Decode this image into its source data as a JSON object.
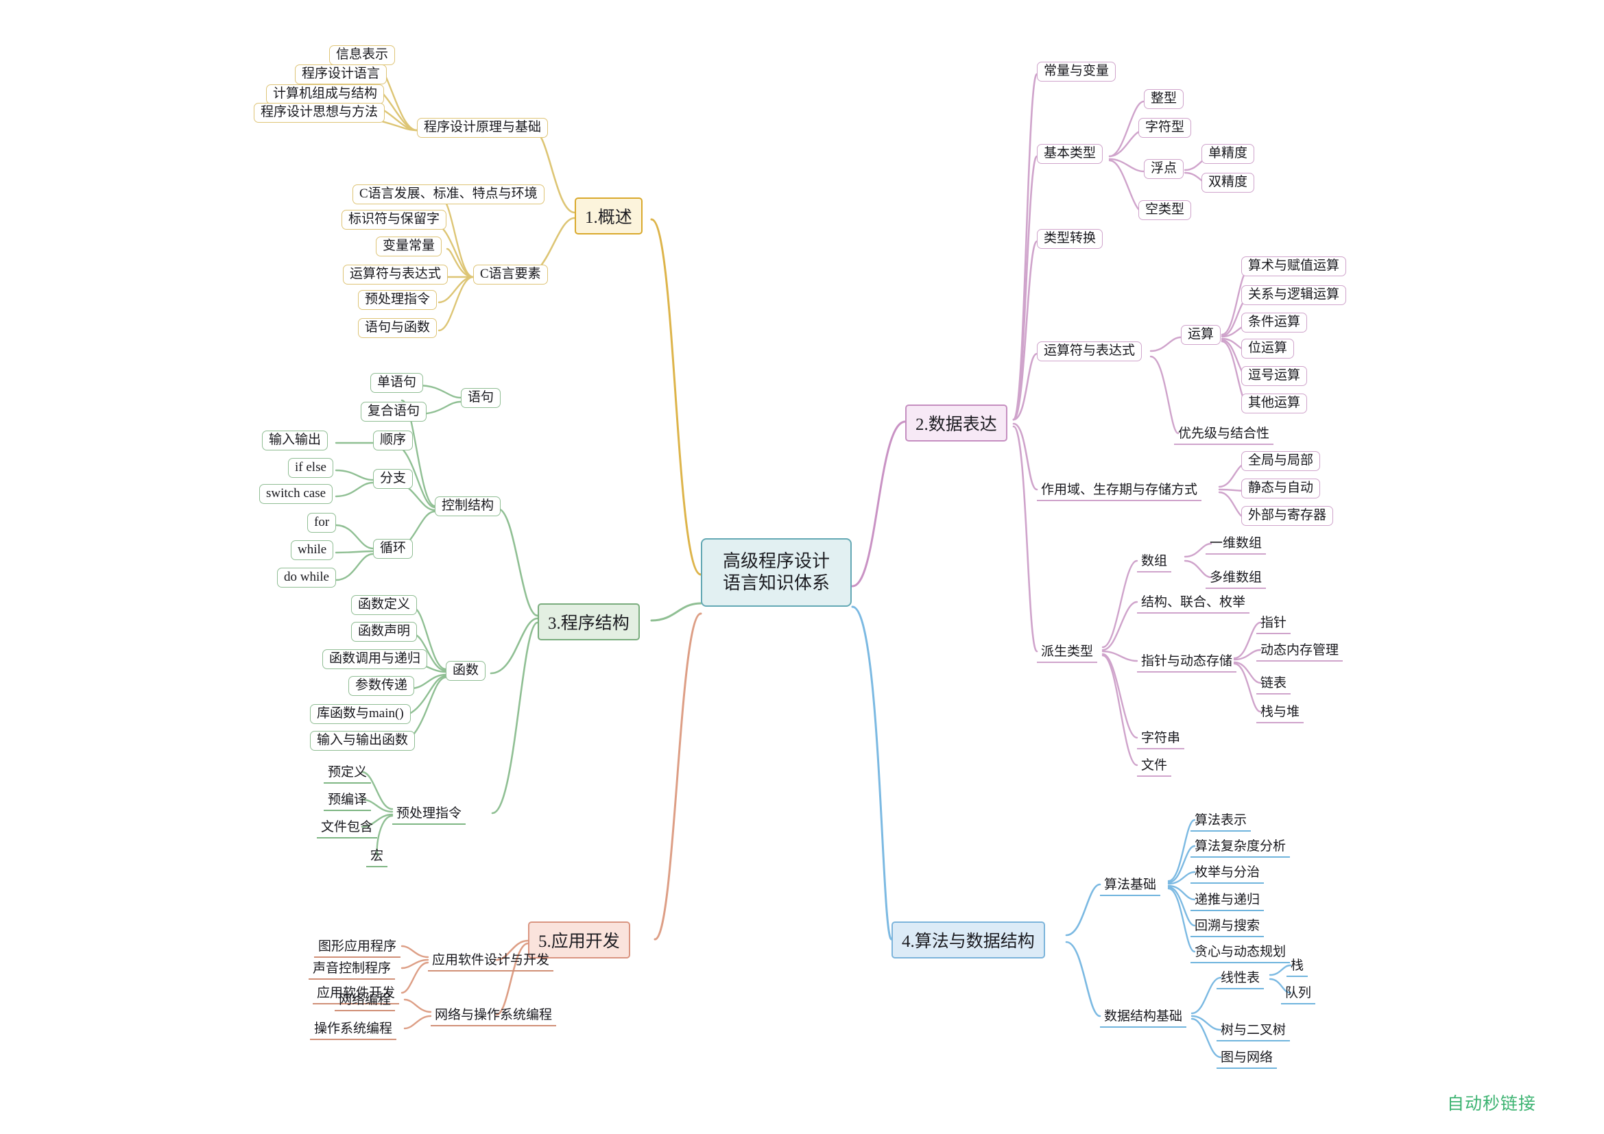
{
  "diagram": {
    "type": "mindmap",
    "root": {
      "label": "高级程序设计\n语言知识体系",
      "line1": "高级程序设计",
      "line2": "语言知识体系",
      "color": "#63a8b4",
      "fill": "#e2f0f2"
    },
    "watermark": "自动秒链接",
    "watermark_color": "#3cb371",
    "branches": [
      {
        "id": "b1",
        "label": "1.概述",
        "color": "#d9a92c",
        "fill": "#fcf4dc",
        "side": "left",
        "children": [
          {
            "label": "程序设计原理与基础",
            "children": [
              {
                "label": "信息表示"
              },
              {
                "label": "程序设计语言"
              },
              {
                "label": "计算机组成与结构"
              },
              {
                "label": "程序设计思想与方法"
              }
            ]
          },
          {
            "label": "C语言要素",
            "children": [
              {
                "label": "C语言发展、标准、特点与环境"
              },
              {
                "label": "标识符与保留字"
              },
              {
                "label": "变量常量"
              },
              {
                "label": "运算符与表达式"
              },
              {
                "label": "预处理指令"
              },
              {
                "label": "语句与函数"
              }
            ]
          }
        ]
      },
      {
        "id": "b2",
        "label": "2.数据表达",
        "color": "#c58ec0",
        "fill": "#f7e9f6",
        "side": "right",
        "children": [
          {
            "label": "常量与变量",
            "children": []
          },
          {
            "label": "基本类型",
            "children": [
              {
                "label": "整型"
              },
              {
                "label": "字符型"
              },
              {
                "label": "浮点",
                "children": [
                  {
                    "label": "单精度"
                  },
                  {
                    "label": "双精度"
                  }
                ]
              },
              {
                "label": "空类型"
              }
            ]
          },
          {
            "label": "类型转换",
            "children": []
          },
          {
            "label": "运算符与表达式",
            "children": [
              {
                "label": "运算",
                "children": [
                  {
                    "label": "算术与赋值运算"
                  },
                  {
                    "label": "关系与逻辑运算"
                  },
                  {
                    "label": "条件运算"
                  },
                  {
                    "label": "位运算"
                  },
                  {
                    "label": "逗号运算"
                  },
                  {
                    "label": "其他运算"
                  }
                ]
              },
              {
                "label": "优先级与结合性"
              }
            ]
          },
          {
            "label": "作用域、生存期与存储方式",
            "children": [
              {
                "label": "全局与局部"
              },
              {
                "label": "静态与自动"
              },
              {
                "label": "外部与寄存器"
              }
            ]
          },
          {
            "label": "派生类型",
            "children": [
              {
                "label": "数组",
                "children": [
                  {
                    "label": "一维数组"
                  },
                  {
                    "label": "多维数组"
                  }
                ]
              },
              {
                "label": "结构、联合、枚举"
              },
              {
                "label": "指针与动态存储",
                "children": [
                  {
                    "label": "指针"
                  },
                  {
                    "label": "动态内存管理"
                  },
                  {
                    "label": "链表"
                  },
                  {
                    "label": "栈与堆"
                  }
                ]
              },
              {
                "label": "字符串"
              },
              {
                "label": "文件"
              }
            ]
          }
        ]
      },
      {
        "id": "b3",
        "label": "3.程序结构",
        "color": "#79ac7d",
        "fill": "#e3efe2",
        "side": "left",
        "children": [
          {
            "label": "控制结构",
            "children": [
              {
                "label": "语句",
                "children": [
                  {
                    "label": "单语句"
                  },
                  {
                    "label": "复合语句"
                  }
                ]
              },
              {
                "label": "顺序",
                "children": [
                  {
                    "label": "输入输出"
                  }
                ]
              },
              {
                "label": "分支",
                "children": [
                  {
                    "label": "if else"
                  },
                  {
                    "label": "switch case"
                  }
                ]
              },
              {
                "label": "循环",
                "children": [
                  {
                    "label": "for"
                  },
                  {
                    "label": "while"
                  },
                  {
                    "label": "do while"
                  }
                ]
              }
            ]
          },
          {
            "label": "函数",
            "children": [
              {
                "label": "函数定义"
              },
              {
                "label": "函数声明"
              },
              {
                "label": "函数调用与递归"
              },
              {
                "label": "参数传递"
              },
              {
                "label": "库函数与main()"
              },
              {
                "label": "输入与输出函数"
              }
            ]
          },
          {
            "label": "预处理指令",
            "children": [
              {
                "label": "预定义"
              },
              {
                "label": "预编译"
              },
              {
                "label": "文件包含"
              },
              {
                "label": "宏"
              }
            ]
          }
        ]
      },
      {
        "id": "b4",
        "label": "4.算法与数据结构",
        "color": "#7cb4db",
        "fill": "#dcebf7",
        "side": "right",
        "children": [
          {
            "label": "算法基础",
            "children": [
              {
                "label": "算法表示"
              },
              {
                "label": "算法复杂度分析"
              },
              {
                "label": "枚举与分治"
              },
              {
                "label": "递推与递归"
              },
              {
                "label": "回溯与搜索"
              },
              {
                "label": "贪心与动态规划"
              }
            ]
          },
          {
            "label": "数据结构基础",
            "children": [
              {
                "label": "线性表",
                "children": [
                  {
                    "label": "栈"
                  },
                  {
                    "label": "队列"
                  }
                ]
              },
              {
                "label": "树与二叉树"
              },
              {
                "label": "图与网络"
              }
            ]
          }
        ]
      },
      {
        "id": "b5",
        "label": "5.应用开发",
        "color": "#da9581",
        "fill": "#fae3dc",
        "side": "left",
        "children": [
          {
            "label": "应用软件设计与开发",
            "children": [
              {
                "label": "图形应用程序"
              },
              {
                "label": "声音控制程序"
              },
              {
                "label": "应用软件开发"
              }
            ]
          },
          {
            "label": "网络与操作系统编程",
            "children": [
              {
                "label": "网络编程"
              },
              {
                "label": "操作系统编程"
              }
            ]
          }
        ]
      }
    ]
  }
}
